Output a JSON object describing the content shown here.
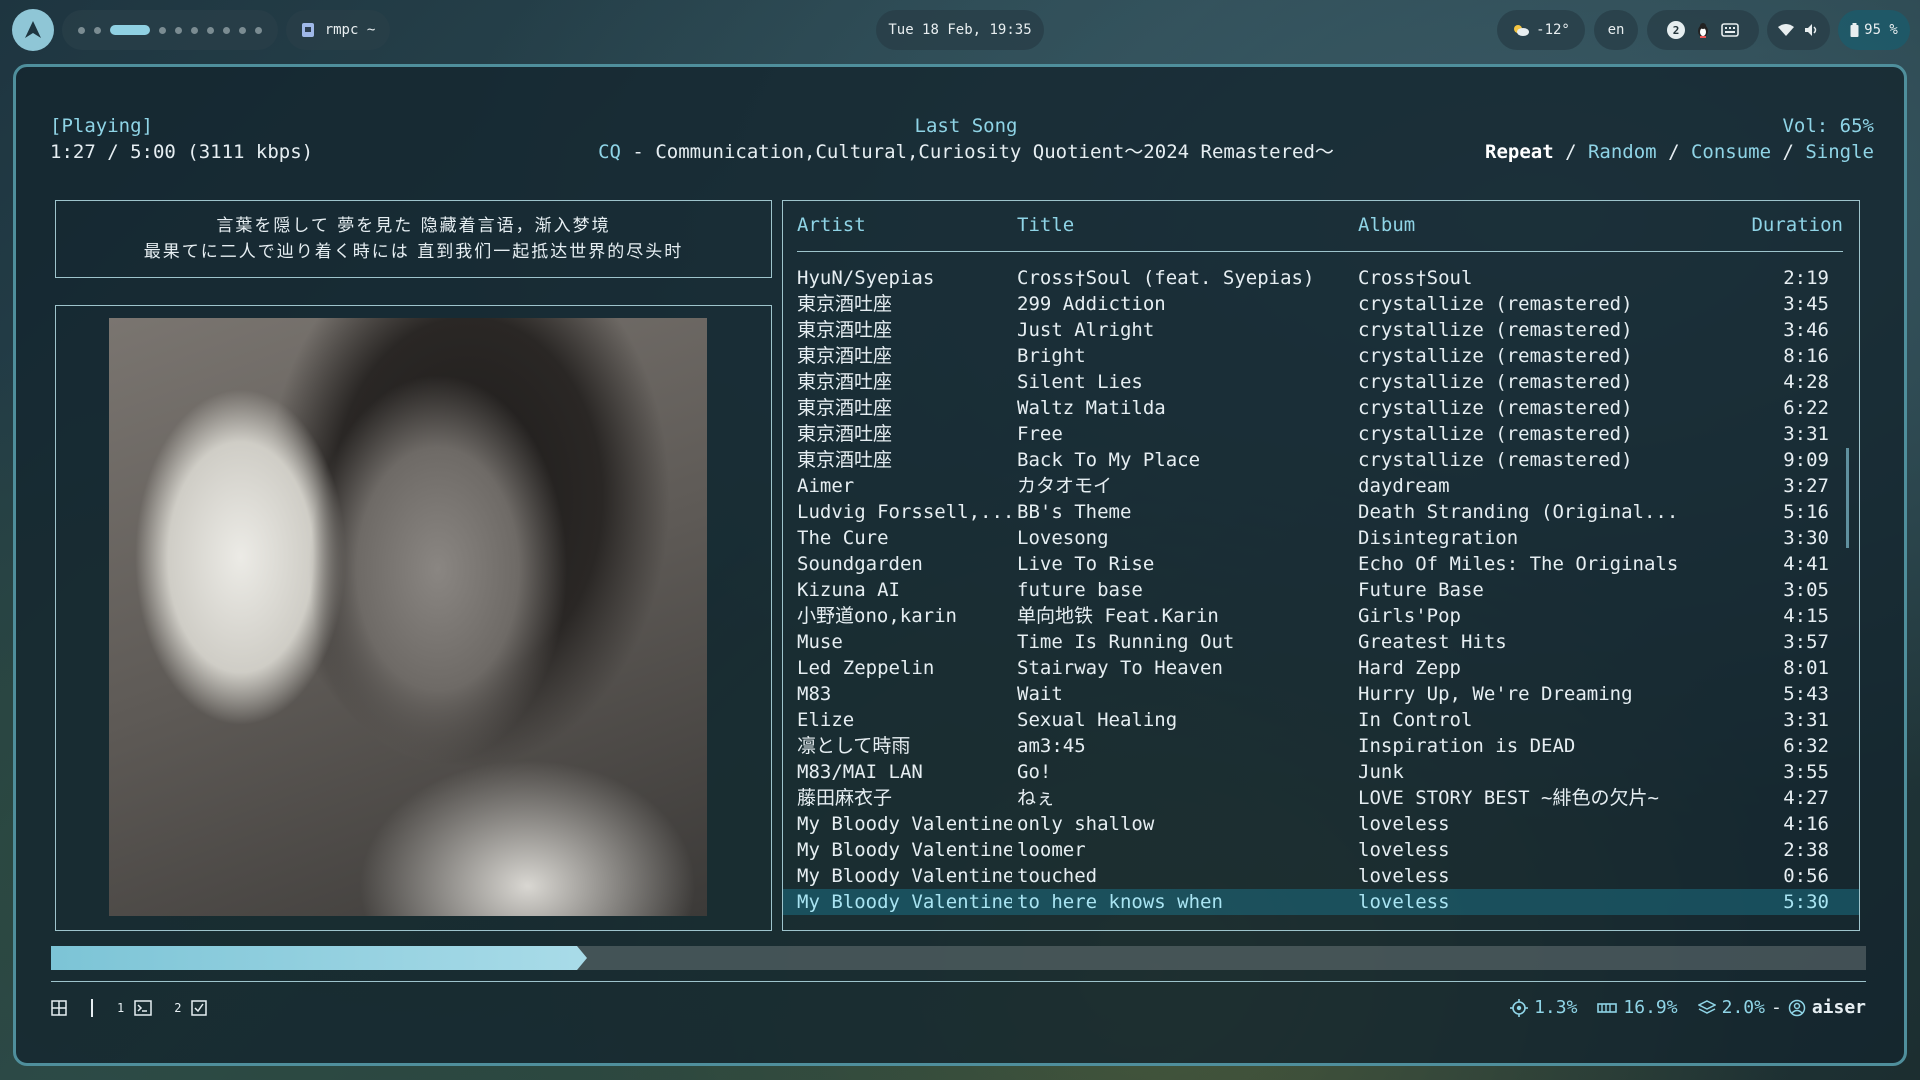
{
  "topbar": {
    "window_title": "rmpc ~",
    "clock": "Tue 18 Feb, 19:35",
    "weather": "-12°",
    "language": "en",
    "notification_count": "2",
    "battery": "95 %",
    "workspaces": {
      "total": 10,
      "active_index": 2
    }
  },
  "player": {
    "state": "[Playing]",
    "time": "1:27 / 5:00 (3111 kbps)",
    "song_title": "Last Song",
    "song_artist": "CQ",
    "song_separator": " - ",
    "song_album": "Communication,Cultural,Curiosity Quotient～2024 Remastered～",
    "volume": "Vol: 65%",
    "modes": {
      "repeat": "Repeat",
      "random": "Random",
      "consume": "Consume",
      "single": "Single",
      "sep": " / "
    },
    "progress_fraction": 0.29
  },
  "lyrics": {
    "line1": "言葉を隠して 夢を見た 隐藏着言语，渐入梦境",
    "line2": "最果てに二人で辿り着く時には 直到我们一起抵达世界的尽头时"
  },
  "playlist": {
    "headers": {
      "artist": "Artist",
      "title": "Title",
      "album": "Album",
      "duration": "Duration"
    },
    "rows": [
      {
        "artist": "HyuN/Syepias",
        "title": "Cross†Soul (feat. Syepias)",
        "album": "Cross†Soul",
        "duration": "2:19"
      },
      {
        "artist": "東京酒吐座",
        "title": "299 Addiction",
        "album": "crystallize (remastered)",
        "duration": "3:45"
      },
      {
        "artist": "東京酒吐座",
        "title": "Just Alright",
        "album": "crystallize (remastered)",
        "duration": "3:46"
      },
      {
        "artist": "東京酒吐座",
        "title": "Bright",
        "album": "crystallize (remastered)",
        "duration": "8:16"
      },
      {
        "artist": "東京酒吐座",
        "title": "Silent Lies",
        "album": "crystallize (remastered)",
        "duration": "4:28"
      },
      {
        "artist": "東京酒吐座",
        "title": "Waltz Matilda",
        "album": "crystallize (remastered)",
        "duration": "6:22"
      },
      {
        "artist": "東京酒吐座",
        "title": "Free",
        "album": "crystallize (remastered)",
        "duration": "3:31"
      },
      {
        "artist": "東京酒吐座",
        "title": "Back To My Place",
        "album": "crystallize (remastered)",
        "duration": "9:09"
      },
      {
        "artist": "Aimer",
        "title": "カタオモイ",
        "album": "daydream",
        "duration": "3:27"
      },
      {
        "artist": "Ludvig Forssell,...",
        "title": "BB's Theme",
        "album": "Death Stranding (Original...",
        "duration": "5:16"
      },
      {
        "artist": "The Cure",
        "title": "Lovesong",
        "album": "Disintegration",
        "duration": "3:30"
      },
      {
        "artist": "Soundgarden",
        "title": "Live To Rise",
        "album": "Echo Of Miles: The Originals",
        "duration": "4:41"
      },
      {
        "artist": "Kizuna AI",
        "title": "future base",
        "album": "Future Base",
        "duration": "3:05"
      },
      {
        "artist": "小野道ono,karin",
        "title": "单向地铁 Feat.Karin",
        "album": "Girls'Pop",
        "duration": "4:15"
      },
      {
        "artist": "Muse",
        "title": "Time Is Running Out",
        "album": "Greatest Hits",
        "duration": "3:57"
      },
      {
        "artist": "Led Zeppelin",
        "title": "Stairway To Heaven",
        "album": "Hard Zepp",
        "duration": "8:01"
      },
      {
        "artist": "M83",
        "title": "Wait",
        "album": "Hurry Up, We're Dreaming",
        "duration": "5:43"
      },
      {
        "artist": "Elize",
        "title": "Sexual Healing",
        "album": "In Control",
        "duration": "3:31"
      },
      {
        "artist": "凛として時雨",
        "title": "am3:45",
        "album": "Inspiration is DEAD",
        "duration": "6:32"
      },
      {
        "artist": "M83/MAI LAN",
        "title": "Go!",
        "album": "Junk",
        "duration": "3:55"
      },
      {
        "artist": "藤田麻衣子",
        "title": "ねぇ",
        "album": "LOVE STORY BEST ~緋色の欠片~",
        "duration": "4:27"
      },
      {
        "artist": "My Bloody Valentine",
        "title": "only shallow",
        "album": "loveless",
        "duration": "4:16"
      },
      {
        "artist": "My Bloody Valentine",
        "title": "loomer",
        "album": "loveless",
        "duration": "2:38"
      },
      {
        "artist": "My Bloody Valentine",
        "title": "touched",
        "album": "loveless",
        "duration": "0:56"
      },
      {
        "artist": "My Bloody Valentine",
        "title": "to here knows when",
        "album": "loveless",
        "duration": "5:30"
      }
    ],
    "current_index": 24
  },
  "statusbar": {
    "ws1": "1",
    "ws2": "2",
    "cpu": "1.3%",
    "mem": "16.9%",
    "disk": "2.0%",
    "dash": "-",
    "user": "aiser"
  },
  "colors": {
    "accent": "#8fd4e6",
    "border": "#9ec4cc",
    "progress": "#7cc4d6"
  }
}
